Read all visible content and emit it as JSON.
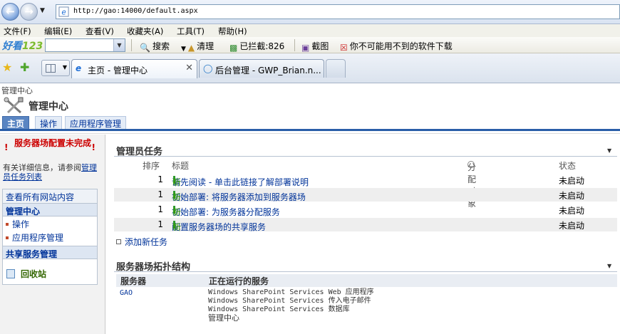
{
  "browser": {
    "url": "http://gao:14000/default.aspx",
    "menu": [
      "文件(F)",
      "编辑(E)",
      "查看(V)",
      "收藏夹(A)",
      "工具(T)",
      "帮助(H)"
    ],
    "toolbar": {
      "brand_a": "好看",
      "brand_b": "123",
      "search": "搜索",
      "clean": "清理",
      "blocked": "已拦截:826",
      "screenshot": "截图",
      "ad": "你不可能用不到的软件下载"
    },
    "tabs": [
      {
        "label": "主页 - 管理中心",
        "active": true
      },
      {
        "label": "后台管理 - GWP_Brian.n...",
        "active": false
      }
    ]
  },
  "page": {
    "breadcrumb": "管理中心",
    "title": "管理中心",
    "topnav": [
      "主页",
      "操作",
      "应用程序管理"
    ]
  },
  "leftnav": {
    "warning": "服务器场配置未完成",
    "info_prefix": "有关详细信息，请参阅",
    "info_link": "管理员任务列表",
    "view_all": "查看所有网站内容",
    "section1": "管理中心",
    "items": [
      "操作",
      "应用程序管理"
    ],
    "section2": "共享服务管理",
    "recycle": "回收站"
  },
  "admin_tasks": {
    "title": "管理员任务",
    "columns": {
      "order": "排序",
      "title": "标题",
      "assigned": "分配对象",
      "status": "状态"
    },
    "rows": [
      {
        "order": "1",
        "task": "请先阅读 - 单击此链接了解部署说明",
        "new": "新",
        "status": "未启动"
      },
      {
        "order": "1",
        "task": "初始部署: 将服务器添加到服务器场",
        "new": "新",
        "status": "未启动"
      },
      {
        "order": "1",
        "task": "初始部署: 为服务器分配服务",
        "new": "新",
        "status": "未启动"
      },
      {
        "order": "1",
        "task": "配置服务器场的共享服务",
        "new": "新",
        "status": "未启动"
      }
    ],
    "add_task": "添加新任务"
  },
  "topology": {
    "title": "服务器场拓扑结构",
    "col_server": "服务器",
    "col_services": "正在运行的服务",
    "server": "GAO",
    "services": [
      "Windows SharePoint Services Web 应用程序",
      "Windows SharePoint Services 传入电子邮件",
      "Windows SharePoint Services 数据库",
      "管理中心"
    ]
  }
}
